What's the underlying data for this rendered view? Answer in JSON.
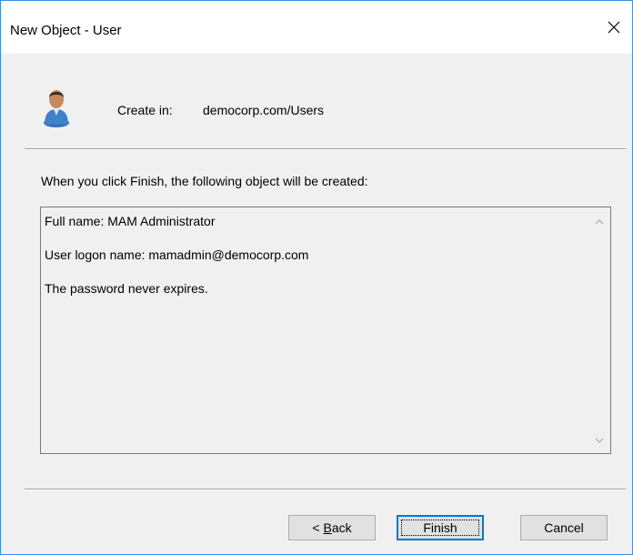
{
  "window": {
    "title": "New Object - User"
  },
  "header": {
    "create_in_label": "Create in:",
    "create_in_value": "democorp.com/Users"
  },
  "info": {
    "text": "When you click Finish, the following object will be created:"
  },
  "summary": {
    "lines": [
      "Full name: MAM Administrator",
      "User logon name: mamadmin@democorp.com",
      "The password never expires."
    ]
  },
  "buttons": {
    "back_prefix": "< ",
    "back_mnemonic": "B",
    "back_rest": "ack",
    "finish": "Finish",
    "cancel": "Cancel"
  },
  "icons": {
    "close": "close-icon",
    "user": "user-icon",
    "scroll_up": "chevron-up-icon",
    "scroll_down": "chevron-down-icon"
  },
  "colors": {
    "window_border": "#3a8ee6",
    "dialog_bg": "#f0f0f0",
    "default_button_border": "#0078d7"
  }
}
